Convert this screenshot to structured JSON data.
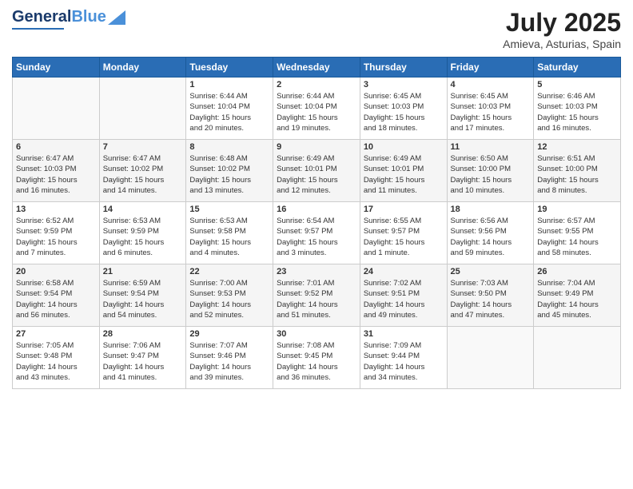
{
  "header": {
    "logo_general": "General",
    "logo_blue": "Blue",
    "month_title": "July 2025",
    "location": "Amieva, Asturias, Spain"
  },
  "weekdays": [
    "Sunday",
    "Monday",
    "Tuesday",
    "Wednesday",
    "Thursday",
    "Friday",
    "Saturday"
  ],
  "weeks": [
    [
      {
        "day": "",
        "info": ""
      },
      {
        "day": "",
        "info": ""
      },
      {
        "day": "1",
        "info": "Sunrise: 6:44 AM\nSunset: 10:04 PM\nDaylight: 15 hours\nand 20 minutes."
      },
      {
        "day": "2",
        "info": "Sunrise: 6:44 AM\nSunset: 10:04 PM\nDaylight: 15 hours\nand 19 minutes."
      },
      {
        "day": "3",
        "info": "Sunrise: 6:45 AM\nSunset: 10:03 PM\nDaylight: 15 hours\nand 18 minutes."
      },
      {
        "day": "4",
        "info": "Sunrise: 6:45 AM\nSunset: 10:03 PM\nDaylight: 15 hours\nand 17 minutes."
      },
      {
        "day": "5",
        "info": "Sunrise: 6:46 AM\nSunset: 10:03 PM\nDaylight: 15 hours\nand 16 minutes."
      }
    ],
    [
      {
        "day": "6",
        "info": "Sunrise: 6:47 AM\nSunset: 10:03 PM\nDaylight: 15 hours\nand 16 minutes."
      },
      {
        "day": "7",
        "info": "Sunrise: 6:47 AM\nSunset: 10:02 PM\nDaylight: 15 hours\nand 14 minutes."
      },
      {
        "day": "8",
        "info": "Sunrise: 6:48 AM\nSunset: 10:02 PM\nDaylight: 15 hours\nand 13 minutes."
      },
      {
        "day": "9",
        "info": "Sunrise: 6:49 AM\nSunset: 10:01 PM\nDaylight: 15 hours\nand 12 minutes."
      },
      {
        "day": "10",
        "info": "Sunrise: 6:49 AM\nSunset: 10:01 PM\nDaylight: 15 hours\nand 11 minutes."
      },
      {
        "day": "11",
        "info": "Sunrise: 6:50 AM\nSunset: 10:00 PM\nDaylight: 15 hours\nand 10 minutes."
      },
      {
        "day": "12",
        "info": "Sunrise: 6:51 AM\nSunset: 10:00 PM\nDaylight: 15 hours\nand 8 minutes."
      }
    ],
    [
      {
        "day": "13",
        "info": "Sunrise: 6:52 AM\nSunset: 9:59 PM\nDaylight: 15 hours\nand 7 minutes."
      },
      {
        "day": "14",
        "info": "Sunrise: 6:53 AM\nSunset: 9:59 PM\nDaylight: 15 hours\nand 6 minutes."
      },
      {
        "day": "15",
        "info": "Sunrise: 6:53 AM\nSunset: 9:58 PM\nDaylight: 15 hours\nand 4 minutes."
      },
      {
        "day": "16",
        "info": "Sunrise: 6:54 AM\nSunset: 9:57 PM\nDaylight: 15 hours\nand 3 minutes."
      },
      {
        "day": "17",
        "info": "Sunrise: 6:55 AM\nSunset: 9:57 PM\nDaylight: 15 hours\nand 1 minute."
      },
      {
        "day": "18",
        "info": "Sunrise: 6:56 AM\nSunset: 9:56 PM\nDaylight: 14 hours\nand 59 minutes."
      },
      {
        "day": "19",
        "info": "Sunrise: 6:57 AM\nSunset: 9:55 PM\nDaylight: 14 hours\nand 58 minutes."
      }
    ],
    [
      {
        "day": "20",
        "info": "Sunrise: 6:58 AM\nSunset: 9:54 PM\nDaylight: 14 hours\nand 56 minutes."
      },
      {
        "day": "21",
        "info": "Sunrise: 6:59 AM\nSunset: 9:54 PM\nDaylight: 14 hours\nand 54 minutes."
      },
      {
        "day": "22",
        "info": "Sunrise: 7:00 AM\nSunset: 9:53 PM\nDaylight: 14 hours\nand 52 minutes."
      },
      {
        "day": "23",
        "info": "Sunrise: 7:01 AM\nSunset: 9:52 PM\nDaylight: 14 hours\nand 51 minutes."
      },
      {
        "day": "24",
        "info": "Sunrise: 7:02 AM\nSunset: 9:51 PM\nDaylight: 14 hours\nand 49 minutes."
      },
      {
        "day": "25",
        "info": "Sunrise: 7:03 AM\nSunset: 9:50 PM\nDaylight: 14 hours\nand 47 minutes."
      },
      {
        "day": "26",
        "info": "Sunrise: 7:04 AM\nSunset: 9:49 PM\nDaylight: 14 hours\nand 45 minutes."
      }
    ],
    [
      {
        "day": "27",
        "info": "Sunrise: 7:05 AM\nSunset: 9:48 PM\nDaylight: 14 hours\nand 43 minutes."
      },
      {
        "day": "28",
        "info": "Sunrise: 7:06 AM\nSunset: 9:47 PM\nDaylight: 14 hours\nand 41 minutes."
      },
      {
        "day": "29",
        "info": "Sunrise: 7:07 AM\nSunset: 9:46 PM\nDaylight: 14 hours\nand 39 minutes."
      },
      {
        "day": "30",
        "info": "Sunrise: 7:08 AM\nSunset: 9:45 PM\nDaylight: 14 hours\nand 36 minutes."
      },
      {
        "day": "31",
        "info": "Sunrise: 7:09 AM\nSunset: 9:44 PM\nDaylight: 14 hours\nand 34 minutes."
      },
      {
        "day": "",
        "info": ""
      },
      {
        "day": "",
        "info": ""
      }
    ]
  ]
}
